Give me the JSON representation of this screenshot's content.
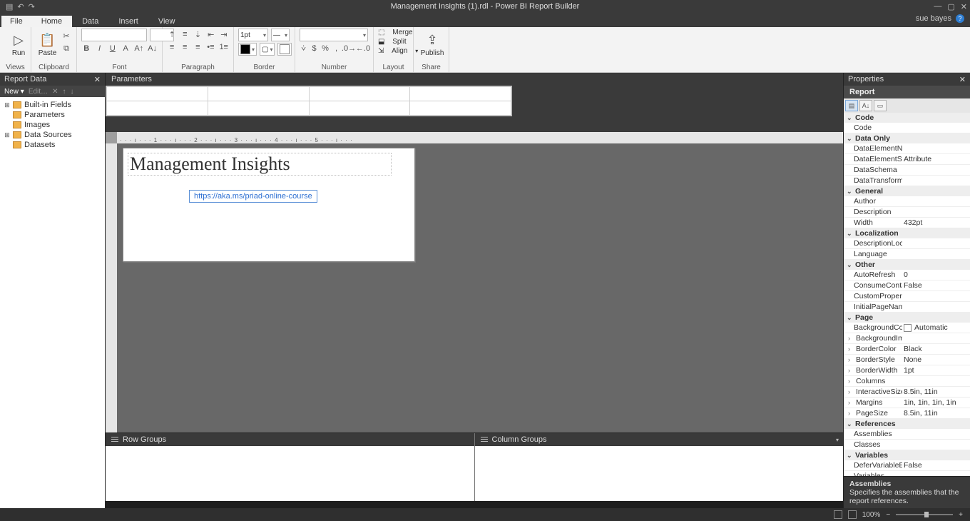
{
  "title": "Management Insights (1).rdl - Power BI Report Builder",
  "user": "sue bayes",
  "tabs": {
    "file": "File",
    "home": "Home",
    "data": "Data",
    "insert": "Insert",
    "view": "View"
  },
  "ribbon": {
    "views": {
      "run": "Run",
      "label": "Views"
    },
    "clipboard": {
      "paste": "Paste",
      "label": "Clipboard"
    },
    "font": {
      "label": "Font"
    },
    "paragraph": {
      "label": "Paragraph"
    },
    "border": {
      "width": "1pt",
      "label": "Border"
    },
    "number": {
      "label": "Number"
    },
    "layout": {
      "merge": "Merge",
      "split": "Split",
      "align": "Align",
      "label": "Layout"
    },
    "share": {
      "publish": "Publish",
      "label": "Share"
    }
  },
  "reportdata": {
    "title": "Report Data",
    "new": "New",
    "edit": "Edit…",
    "items": [
      "Built-in Fields",
      "Parameters",
      "Images",
      "Data Sources",
      "Datasets"
    ]
  },
  "parameters": {
    "title": "Parameters"
  },
  "ruler": "· · · ı · · · 1 · · · ı · · · 2 · · · ı · · · 3 · · · ı · · · 4 · · · ı · · · 5 · · · ı · · ·",
  "design": {
    "title_text": "Management Insights",
    "link_text": "https://aka.ms/priad-online-course"
  },
  "groups": {
    "row": "Row Groups",
    "col": "Column Groups"
  },
  "properties": {
    "title": "Properties",
    "object": "Report",
    "cats": {
      "Code": [
        {
          "k": "Code",
          "v": ""
        }
      ],
      "Data Only": [
        {
          "k": "DataElementName",
          "v": ""
        },
        {
          "k": "DataElementStyle",
          "v": "Attribute"
        },
        {
          "k": "DataSchema",
          "v": ""
        },
        {
          "k": "DataTransform",
          "v": ""
        }
      ],
      "General": [
        {
          "k": "Author",
          "v": ""
        },
        {
          "k": "Description",
          "v": ""
        },
        {
          "k": "Width",
          "v": "432pt"
        }
      ],
      "Localization": [
        {
          "k": "DescriptionLocID",
          "v": ""
        },
        {
          "k": "Language",
          "v": ""
        }
      ],
      "Other": [
        {
          "k": "AutoRefresh",
          "v": "0"
        },
        {
          "k": "ConsumeContainerWhitespace",
          "v": "False"
        },
        {
          "k": "CustomProperties",
          "v": ""
        },
        {
          "k": "InitialPageName",
          "v": ""
        }
      ],
      "Page": [
        {
          "k": "BackgroundColor",
          "v": "Automatic",
          "swatch": true
        },
        {
          "k": "BackgroundImage",
          "v": "",
          "exp": true
        },
        {
          "k": "BorderColor",
          "v": "Black",
          "exp": true
        },
        {
          "k": "BorderStyle",
          "v": "None",
          "exp": true
        },
        {
          "k": "BorderWidth",
          "v": "1pt",
          "exp": true
        },
        {
          "k": "Columns",
          "v": "",
          "exp": true
        },
        {
          "k": "InteractiveSize",
          "v": "8.5in, 11in",
          "exp": true
        },
        {
          "k": "Margins",
          "v": "1in, 1in, 1in, 1in",
          "exp": true
        },
        {
          "k": "PageSize",
          "v": "8.5in, 11in",
          "exp": true
        }
      ],
      "References": [
        {
          "k": "Assemblies",
          "v": ""
        },
        {
          "k": "Classes",
          "v": ""
        }
      ],
      "Variables": [
        {
          "k": "DeferVariableEvaluation",
          "v": "False"
        },
        {
          "k": "Variables",
          "v": ""
        }
      ]
    },
    "desc_title": "Assemblies",
    "desc_body": "Specifies the assemblies that the report references."
  },
  "status": {
    "zoom": "100%"
  }
}
